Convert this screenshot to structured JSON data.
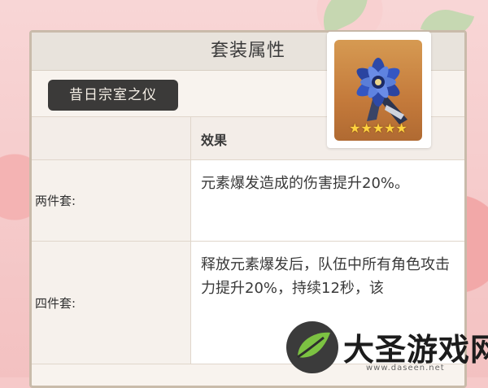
{
  "card": {
    "title": "套装属性",
    "set_name": "昔日宗室之仪"
  },
  "table": {
    "header_effect": "效果",
    "rows": [
      {
        "label": "两件套:",
        "effect": "元素爆发造成的伤害提升20%。"
      },
      {
        "label": "四件套:",
        "effect": "释放元素爆发后，队伍中所有角色攻击力提升20%，持续12秒，该"
      }
    ]
  },
  "artifact": {
    "icon": "blue-flower-artifact-icon",
    "stars": "★★★★★",
    "rarity": 5
  },
  "watermark": {
    "text": "大圣游戏网",
    "url": "www.daseen.net"
  },
  "colors": {
    "background": "#f6c9c9",
    "set_badge": "#3b3a39",
    "card_border": "#c9bbaa",
    "star": "#ffd23f"
  }
}
